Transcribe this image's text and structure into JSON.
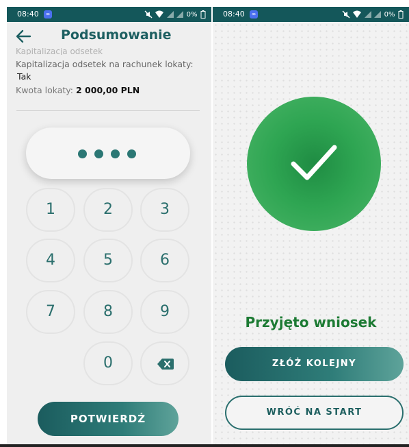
{
  "status_bar": {
    "time": "08:40",
    "battery": "0%"
  },
  "left_screen": {
    "title": "Podsumowanie",
    "faded_text": "Kapitalizacja odsetek",
    "capitalization_label": "Kapitalizacja odsetek na rachunek lokaty:",
    "capitalization_value": "Tak",
    "amount_label": "Kwota lokaty:",
    "amount_value": "2 000,00 PLN",
    "pin_entered_count": 4,
    "keys": [
      "1",
      "2",
      "3",
      "4",
      "5",
      "6",
      "7",
      "8",
      "9",
      "0"
    ],
    "confirm_label": "POTWIERDŹ"
  },
  "right_screen": {
    "result_title": "Przyjęto wniosek",
    "next_label": "ZŁÓŻ KOLEJNY",
    "start_label": "WRÓĆ NA START"
  },
  "colors": {
    "brand_teal": "#1d5f61",
    "status_bar": "#14575a",
    "success_green": "#2ea552",
    "success_text": "#1c7a33"
  },
  "icons": [
    "back-arrow-icon",
    "checkmark-icon",
    "backspace-icon",
    "mute-icon",
    "wifi-icon",
    "battery-icon"
  ]
}
